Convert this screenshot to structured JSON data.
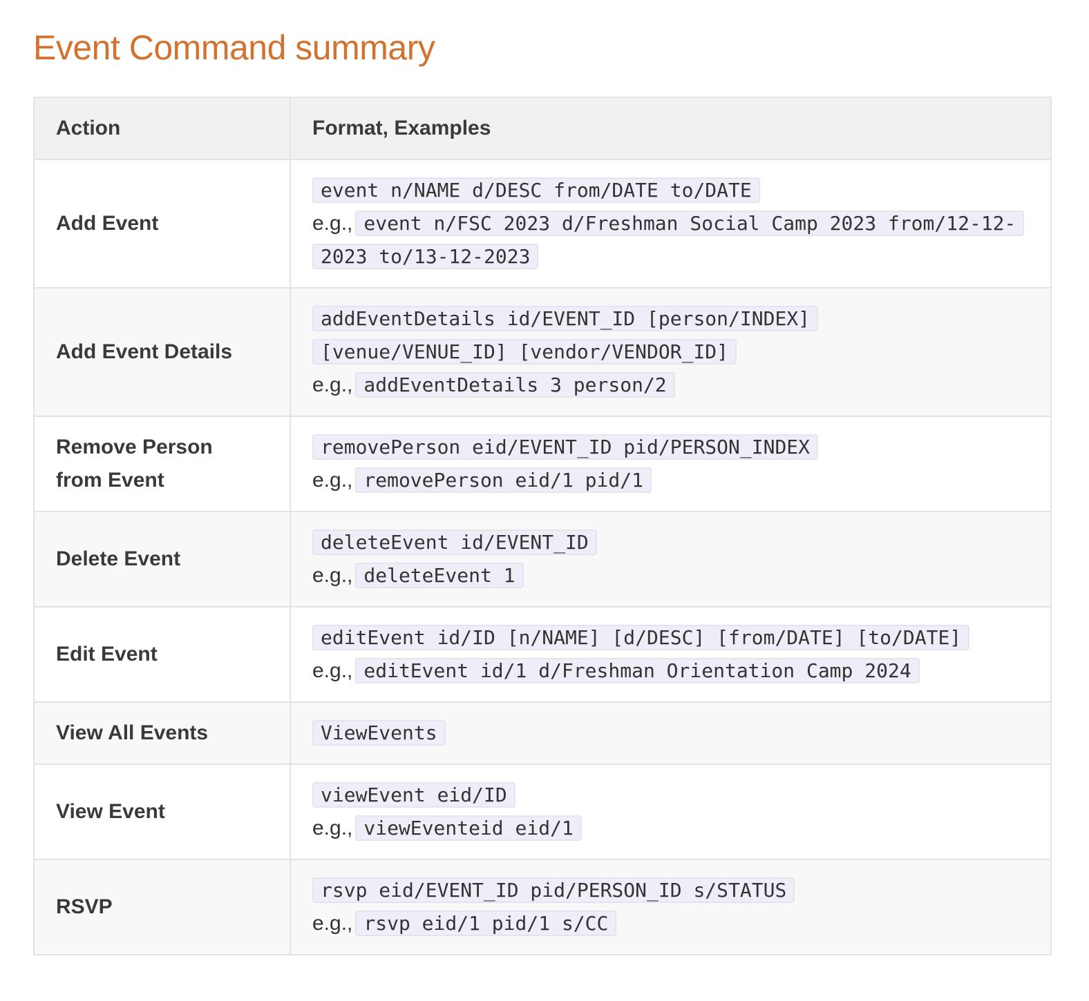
{
  "title": "Event Command summary",
  "table": {
    "headers": [
      "Action",
      "Format, Examples"
    ],
    "eg_prefix": "e.g.,",
    "rows": [
      {
        "action": "Add Event",
        "format": [
          "event n/NAME d/DESC from/DATE to/DATE"
        ],
        "example": "event n/FSC 2023 d/Freshman Social Camp 2023 from/12-12-2023 to/13-12-2023"
      },
      {
        "action": "Add Event Details",
        "format": [
          "addEventDetails id/EVENT_ID [person/INDEX]",
          "[venue/VENUE_ID] [vendor/VENDOR_ID]"
        ],
        "example": "addEventDetails 3 person/2"
      },
      {
        "action": "Remove Person from Event",
        "format": [
          "removePerson eid/EVENT_ID pid/PERSON_INDEX"
        ],
        "example": "removePerson eid/1 pid/1"
      },
      {
        "action": "Delete Event",
        "format": [
          "deleteEvent id/EVENT_ID"
        ],
        "example": "deleteEvent 1"
      },
      {
        "action": "Edit Event",
        "format": [
          "editEvent id/ID [n/NAME] [d/DESC] [from/DATE] [to/DATE]"
        ],
        "example": "editEvent id/1 d/Freshman Orientation Camp 2024"
      },
      {
        "action": "View All Events",
        "format": [
          "ViewEvents"
        ],
        "example": ""
      },
      {
        "action": "View Event",
        "format": [
          "viewEvent eid/ID"
        ],
        "example": "viewEventeid eid/1"
      },
      {
        "action": "RSVP",
        "format": [
          "rsvp eid/EVENT_ID pid/PERSON_ID s/STATUS"
        ],
        "example": "rsvp eid/1 pid/1 s/CC"
      }
    ]
  }
}
